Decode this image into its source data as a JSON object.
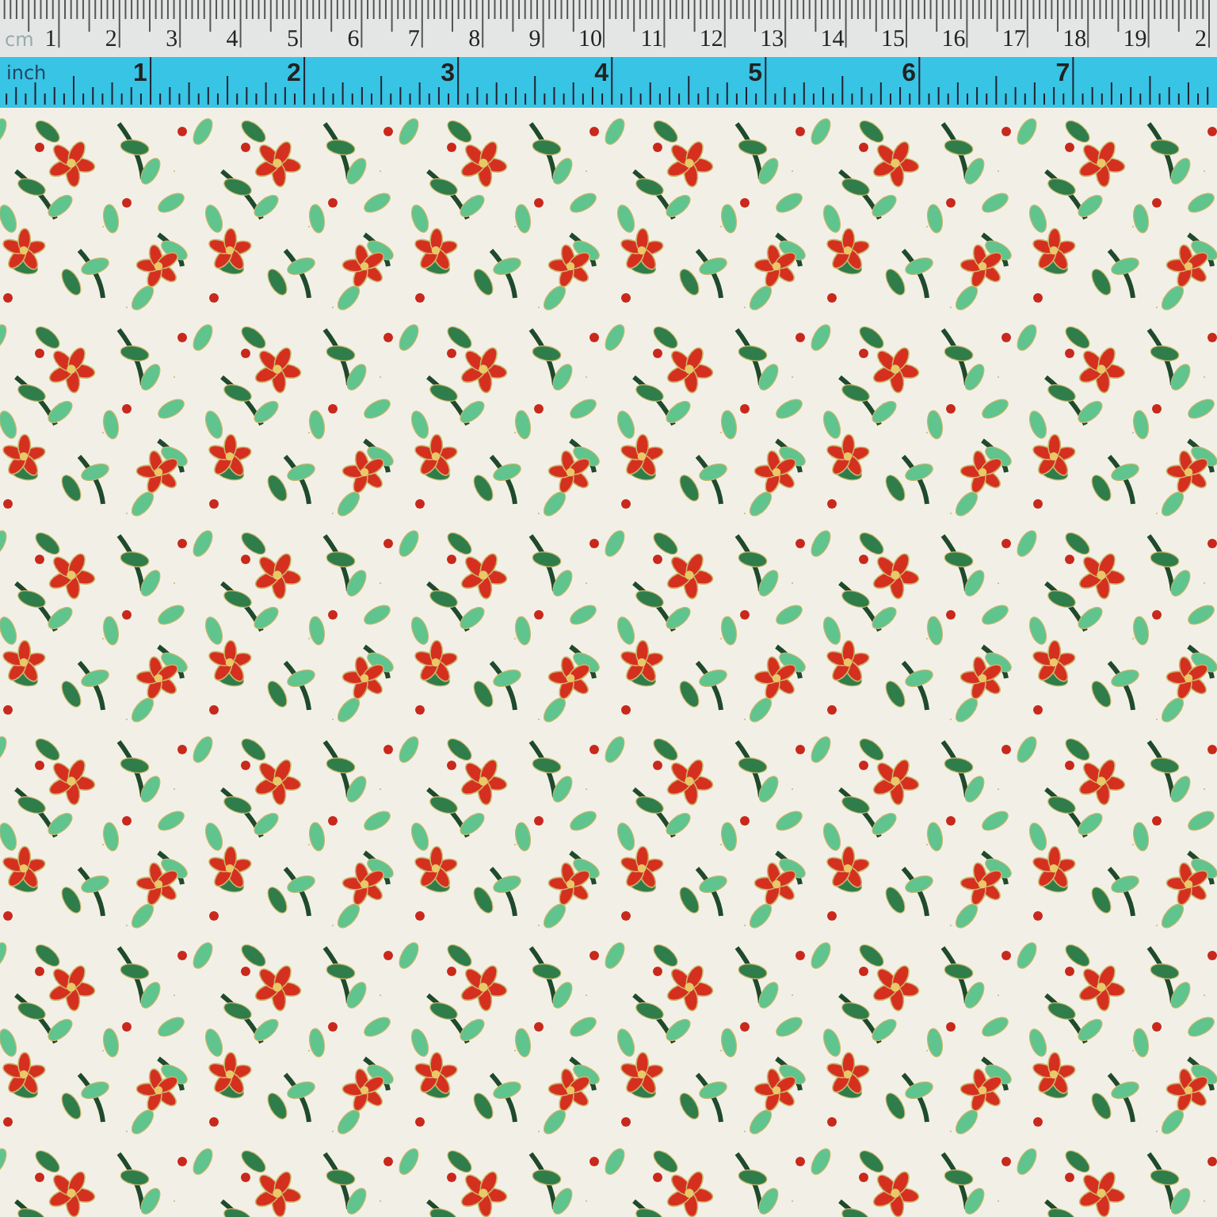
{
  "ruler": {
    "cm_label": "cm",
    "cm_marks": [
      "1",
      "2",
      "3",
      "4",
      "5",
      "6",
      "7",
      "8",
      "9",
      "10",
      "11",
      "12",
      "13",
      "14",
      "15",
      "16",
      "17",
      "18",
      "19",
      "2"
    ],
    "inch_label": "inch",
    "inch_marks": [
      "1",
      "2",
      "3",
      "4",
      "5",
      "6",
      "7"
    ]
  }
}
